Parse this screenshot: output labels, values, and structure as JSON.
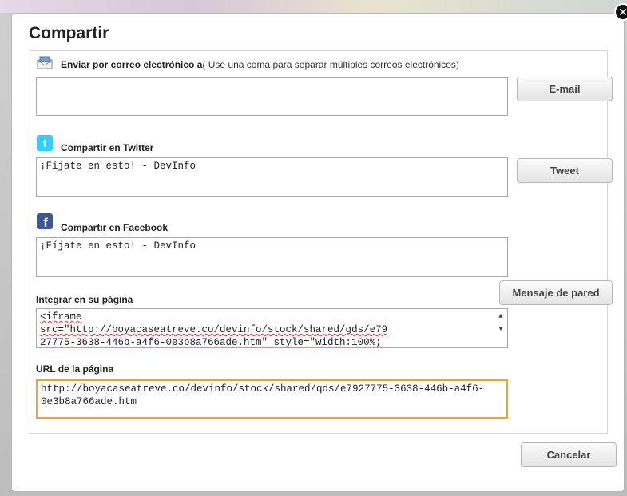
{
  "dialog": {
    "title": "Compartir",
    "close_glyph": "✕"
  },
  "email": {
    "label": "Enviar por correo electrónico a",
    "hint": "( Use una coma para separar múltiples correos electrónicos)",
    "value": "",
    "button": "E-mail",
    "icon": "envelope-icon"
  },
  "twitter": {
    "label": "Compartir en Twitter",
    "value": "¡Fíjate en esto! - DevInfo",
    "button": "Tweet",
    "icon": "twitter-icon",
    "color": "#33ccff"
  },
  "facebook": {
    "label": "Compartir en Facebook",
    "value": "¡Fíjate en esto! - DevInfo",
    "button": "Mensaje de pared",
    "icon": "facebook-icon",
    "color": "#3b5998"
  },
  "embed": {
    "label": "Integrar en su página",
    "line1": "<iframe",
    "line2": "src=\"http://boyacaseatreve.co/devinfo/stock/shared/gds/e79",
    "line3": "27775-3638-446b-a4f6-0e3b8a766ade.htm\" style=\"width:100%;"
  },
  "url": {
    "label": "URL de la página",
    "value": "http://boyacaseatreve.co/devinfo/stock/shared/qds/e7927775-3638-446b-a4f6-0e3b8a766ade.htm"
  },
  "footer": {
    "cancel": "Cancelar"
  },
  "colors": {
    "active_border": "#e3a73a"
  }
}
